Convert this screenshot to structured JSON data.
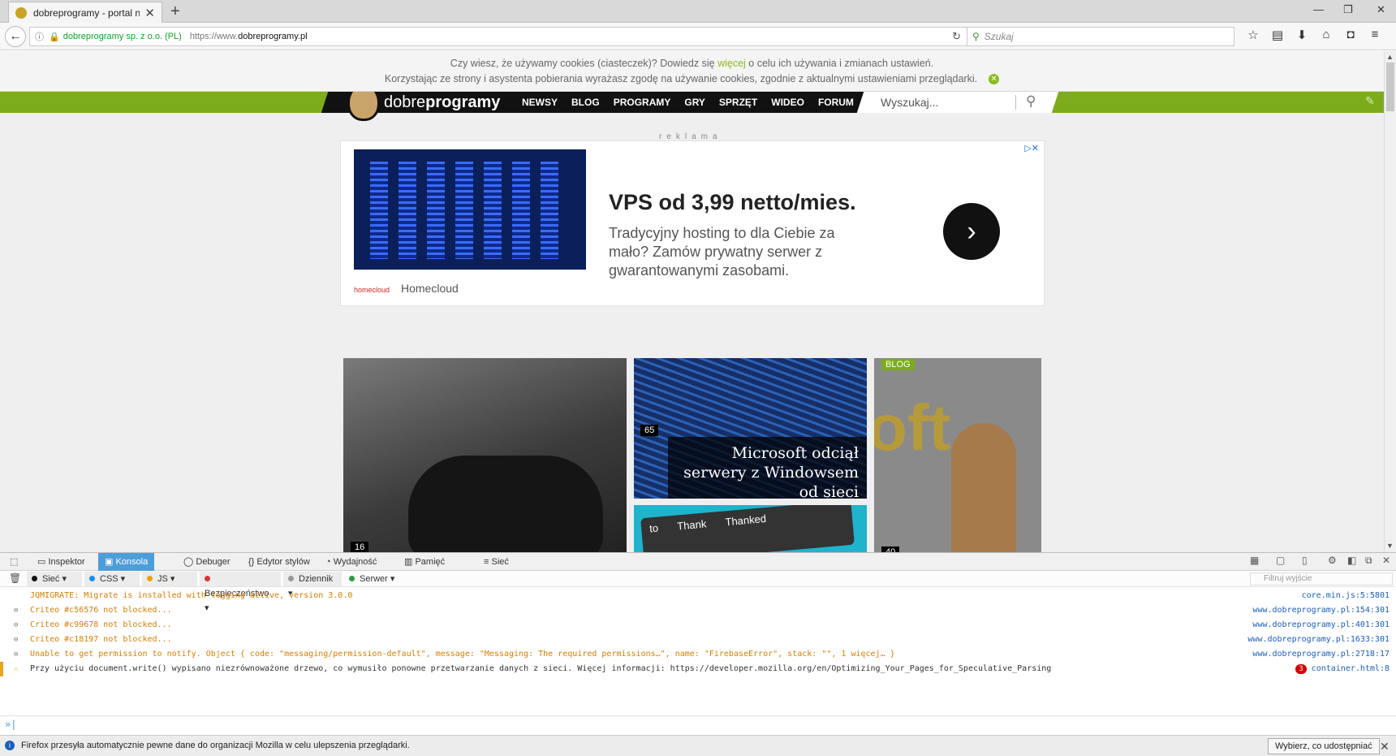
{
  "browser": {
    "tab_title": "dobreprogramy - portal ni...",
    "url_org": "dobreprogramy sp. z o.o. (PL)",
    "url_protocol": "https://www.",
    "url_domain": "dobreprogramy.pl",
    "search_placeholder": "Szukaj"
  },
  "cookie_banner": {
    "line1_before": "Czy wiesz, że używamy cookies (ciasteczek)? Dowiedz się ",
    "line1_link": "więcej",
    "line1_after": " o celu ich używania i zmianach ustawień.",
    "line2": "Korzystając ze strony i asystenta pobierania wyrażasz zgodę na używanie cookies, zgodnie z aktualnymi ustawieniami przeglądarki."
  },
  "site": {
    "logo_light": "dobre",
    "logo_bold": "programy",
    "nav": [
      "NEWSY",
      "BLOG",
      "PROGRAMY",
      "GRY",
      "SPRZĘT",
      "WIDEO",
      "FORUM"
    ],
    "search_placeholder": "Wyszukaj..."
  },
  "ad": {
    "label": "reklama",
    "title": "VPS od 3,99 netto/mies.",
    "description": "Tradycyjny hosting to dla Ciebie za mało? Zamów prywatny serwer z gwarantowanymi zasobami.",
    "brand": "Homecloud",
    "brand_logo": "homecloud"
  },
  "tiles": [
    {
      "comments": "16"
    },
    {
      "comments": "65",
      "caption": "Microsoft odciął serwery z Windowsem od sieci"
    },
    {
      "keys": [
        "to",
        "Thank",
        "Thanked"
      ]
    },
    {
      "badge": "BLOG",
      "comments": "40",
      "logo_text": "oft"
    }
  ],
  "devtools": {
    "tabs": [
      "Inspektor",
      "Konsola",
      "Debuger",
      "Edytor stylów",
      "Wydajność",
      "Pamięć",
      "Sieć"
    ],
    "active_tab": "Konsola",
    "filters": [
      "Sieć",
      "CSS",
      "JS",
      "Bezpieczeństwo",
      "Dziennik",
      "Serwer"
    ],
    "filter_placeholder": "Filtruj wyjście",
    "logs": [
      {
        "msg": "JQMIGRATE: Migrate is installed with logging active, version 3.0.0",
        "src": "core.min.js:5:5801",
        "level": "warn"
      },
      {
        "msg": "Criteo #c56576 not blocked...",
        "src": "www.dobreprogramy.pl:154:301",
        "level": "warn"
      },
      {
        "msg": "Criteo #c99678 not blocked...",
        "src": "www.dobreprogramy.pl:401:301",
        "level": "warn"
      },
      {
        "msg": "Criteo #c18197 not blocked...",
        "src": "www.dobreprogramy.pl:1633:301",
        "level": "warn"
      },
      {
        "msg": "Unable to get permission to notify. Object { code: \"messaging/permission-default\", message: \"Messaging: The required permissions…\", name: \"FirebaseError\", stack: \"\", 1 więcej… }",
        "src": "www.dobreprogramy.pl:2718:17",
        "level": "warn"
      },
      {
        "msg": "Przy użyciu document.write() wypisano niezrównoważone drzewo, co wymusiło ponowne przetwarzanie danych z sieci. Więcej informacji: https://developer.mozilla.org/en/Optimizing_Your_Pages_for_Speculative_Parsing",
        "src": "container.html:8",
        "level": "info",
        "count": "3"
      }
    ]
  },
  "notification": {
    "text": "Firefox przesyła automatycznie pewne dane do organizacji Mozilla w celu ulepszenia przeglądarki.",
    "button": "Wybierz, co udostępniać"
  },
  "colors": {
    "site_green": "#7cac1c",
    "devtools_active": "#4c9ed9",
    "log_warn": "#d97e00",
    "link_blue": "#1a5dbf"
  }
}
